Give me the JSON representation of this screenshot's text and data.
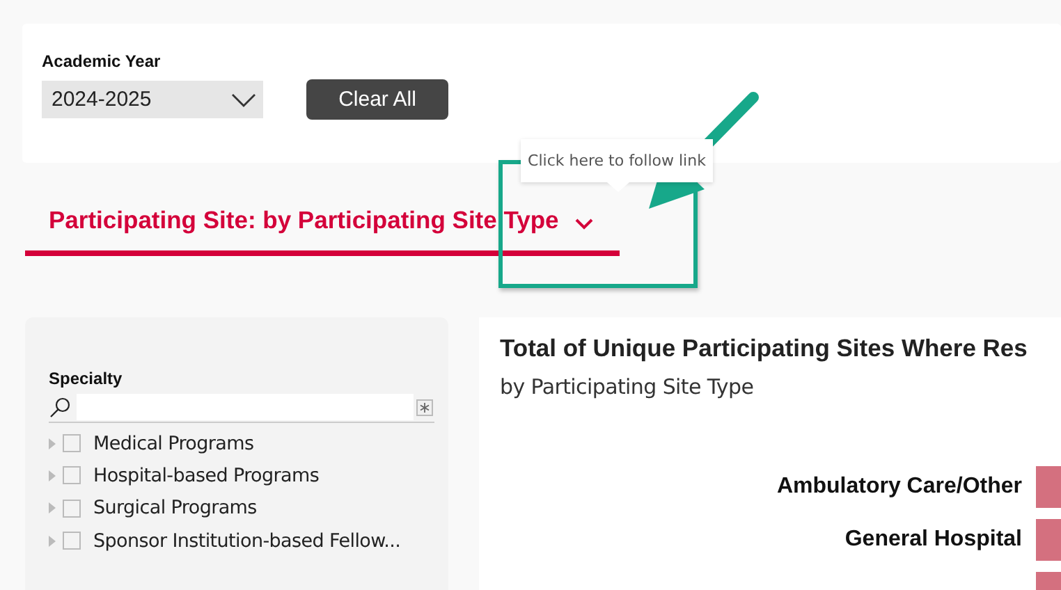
{
  "filters": {
    "academic_year": {
      "label": "Academic Year",
      "value": "2024-2025"
    },
    "clear_button": "Clear All"
  },
  "tooltip": "Click here to follow link",
  "section_title": "Participating Site: by Participating Site Type",
  "specialty_slicer": {
    "label": "Specialty",
    "items": [
      {
        "label": "Medical Programs",
        "checked": false
      },
      {
        "label": "Hospital-based Programs",
        "checked": false
      },
      {
        "label": "Surgical Programs",
        "checked": false
      },
      {
        "label": "Sponsor Institution-based Fellow...",
        "checked": false
      }
    ]
  },
  "chart_card": {
    "title": "Total of Unique Participating Sites Where Res",
    "subtitle": "by Participating Site Type",
    "bars": [
      {
        "kind": "bar",
        "label": "Ambulatory Care/Other"
      },
      {
        "kind": "bar",
        "label": "General Hospital"
      },
      {
        "kind": "bar"
      }
    ]
  }
}
